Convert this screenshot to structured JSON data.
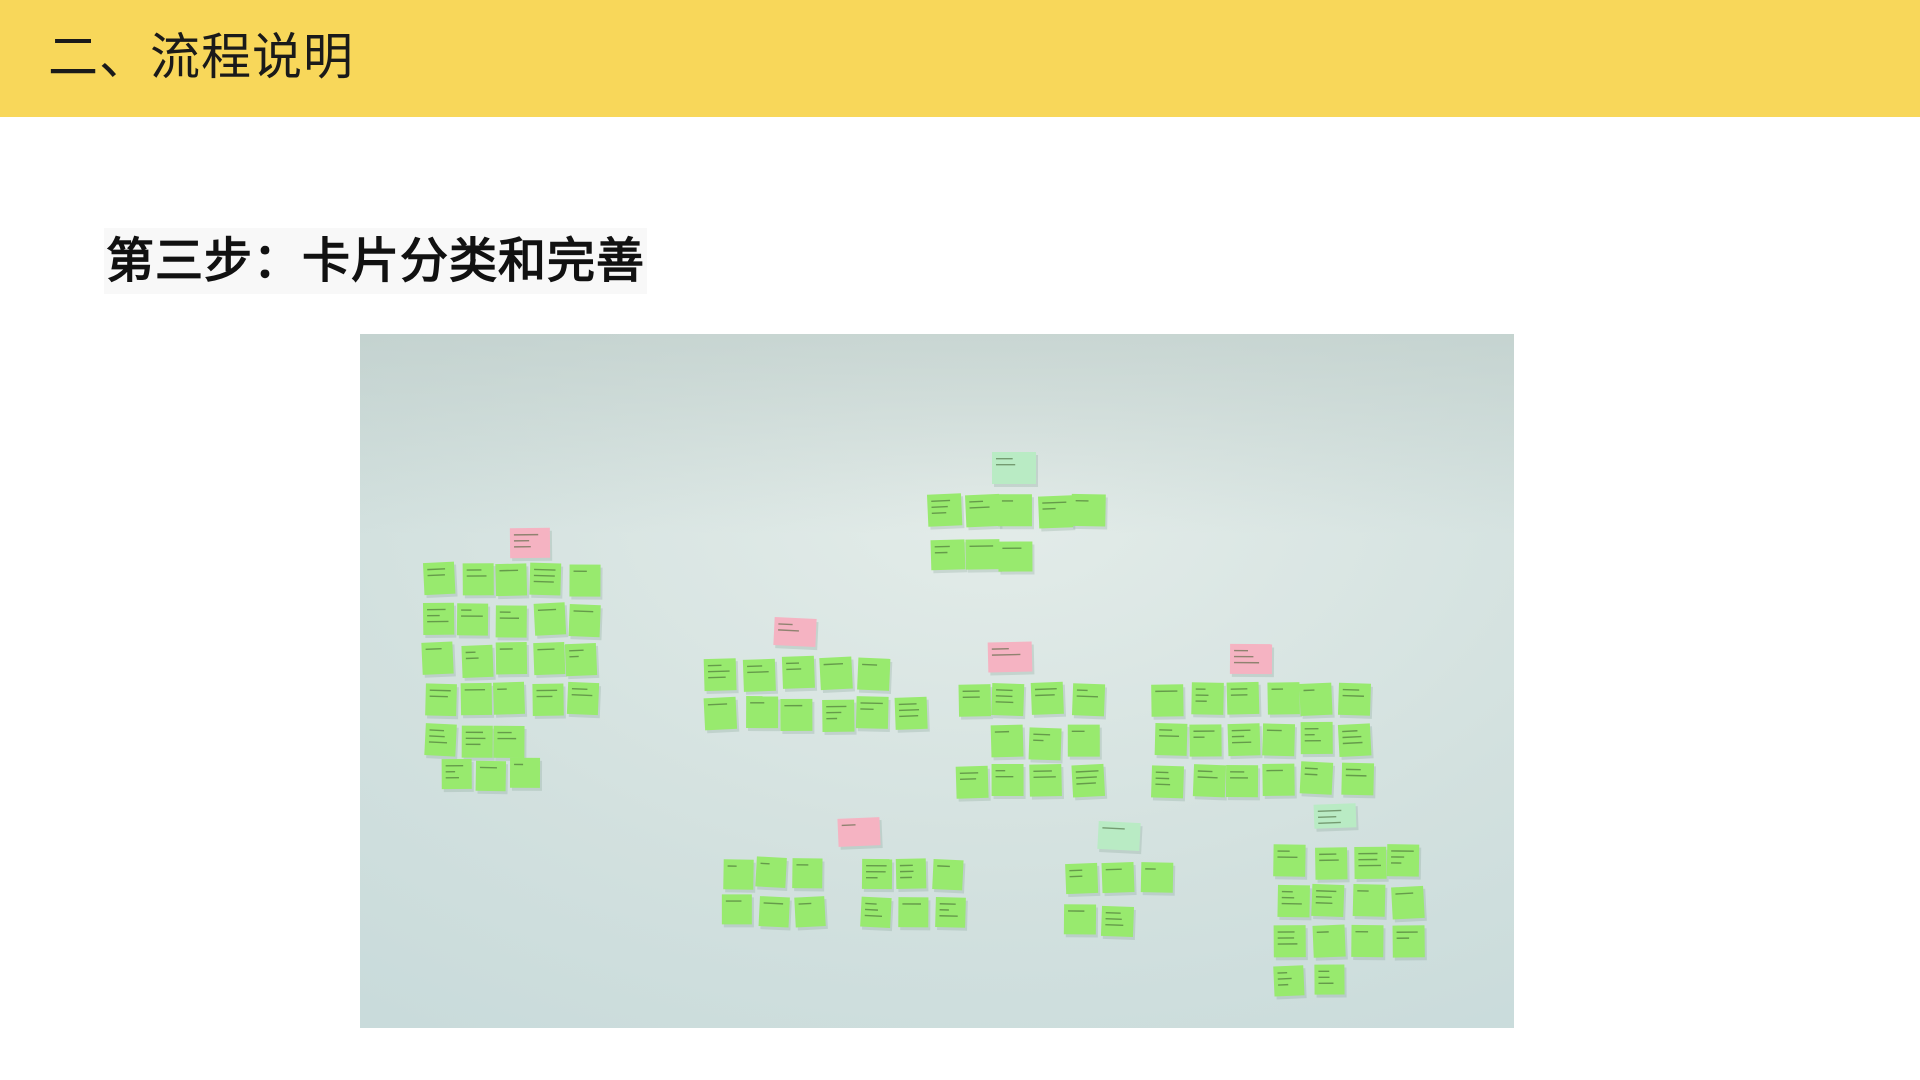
{
  "header": {
    "title": "二、流程说明",
    "bar_color": "#f8d75a"
  },
  "content": {
    "step_heading": "第三步：卡片分类和完善"
  },
  "photo": {
    "subject": "sticky-note-wall",
    "wall_color": "#d6e3e0",
    "note_color_green": "#98ea6e",
    "note_color_pink": "#f5b3c2",
    "note_color_mint": "#b9ebc4"
  }
}
